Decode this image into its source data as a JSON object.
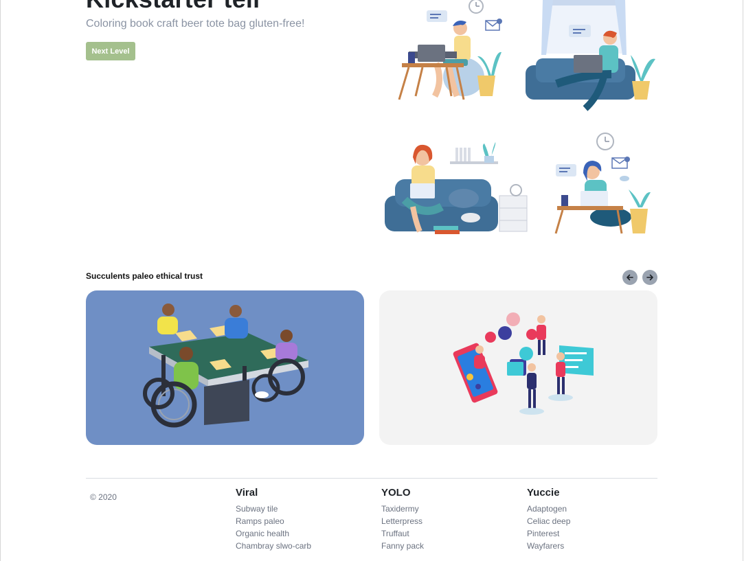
{
  "hero": {
    "title": "Kickstarter tell",
    "subtitle": "Coloring book craft beer tote bag gluten-free!",
    "button_label": "Next Level"
  },
  "illustrations": [
    {
      "icon": "person-at-desk-with-laptop-illustration"
    },
    {
      "icon": "person-on-sofa-with-laptop-illustration"
    },
    {
      "icon": "person-on-couch-with-laptop-illustration"
    },
    {
      "icon": "person-at-table-with-laptop-illustration"
    }
  ],
  "section": {
    "title": "Succulents paleo ethical trust",
    "prev_icon": "arrow-left-icon",
    "next_icon": "arrow-right-icon"
  },
  "cards": [
    {
      "icon": "people-around-table-illustration",
      "bg": "#6f8fc5"
    },
    {
      "icon": "social-media-phone-illustration",
      "bg": "#f3f3f3"
    }
  ],
  "footer": {
    "copyright": "© 2020",
    "columns": [
      {
        "heading": "Viral",
        "links": [
          "Subway tile",
          "Ramps paleo",
          "Organic health",
          "Chambray slwo-carb"
        ]
      },
      {
        "heading": "YOLO",
        "links": [
          "Taxidermy",
          "Letterpress",
          "Truffaut",
          "Fanny pack"
        ]
      },
      {
        "heading": "Yuccie",
        "links": [
          "Adaptogen",
          "Celiac deep",
          "Pinterest",
          "Wayfarers"
        ]
      }
    ]
  },
  "colors": {
    "accent_green": "#a4c08d",
    "card_blue": "#6f8fc5",
    "nav_button": "#9aa3b0",
    "muted_text": "#6b7280"
  }
}
